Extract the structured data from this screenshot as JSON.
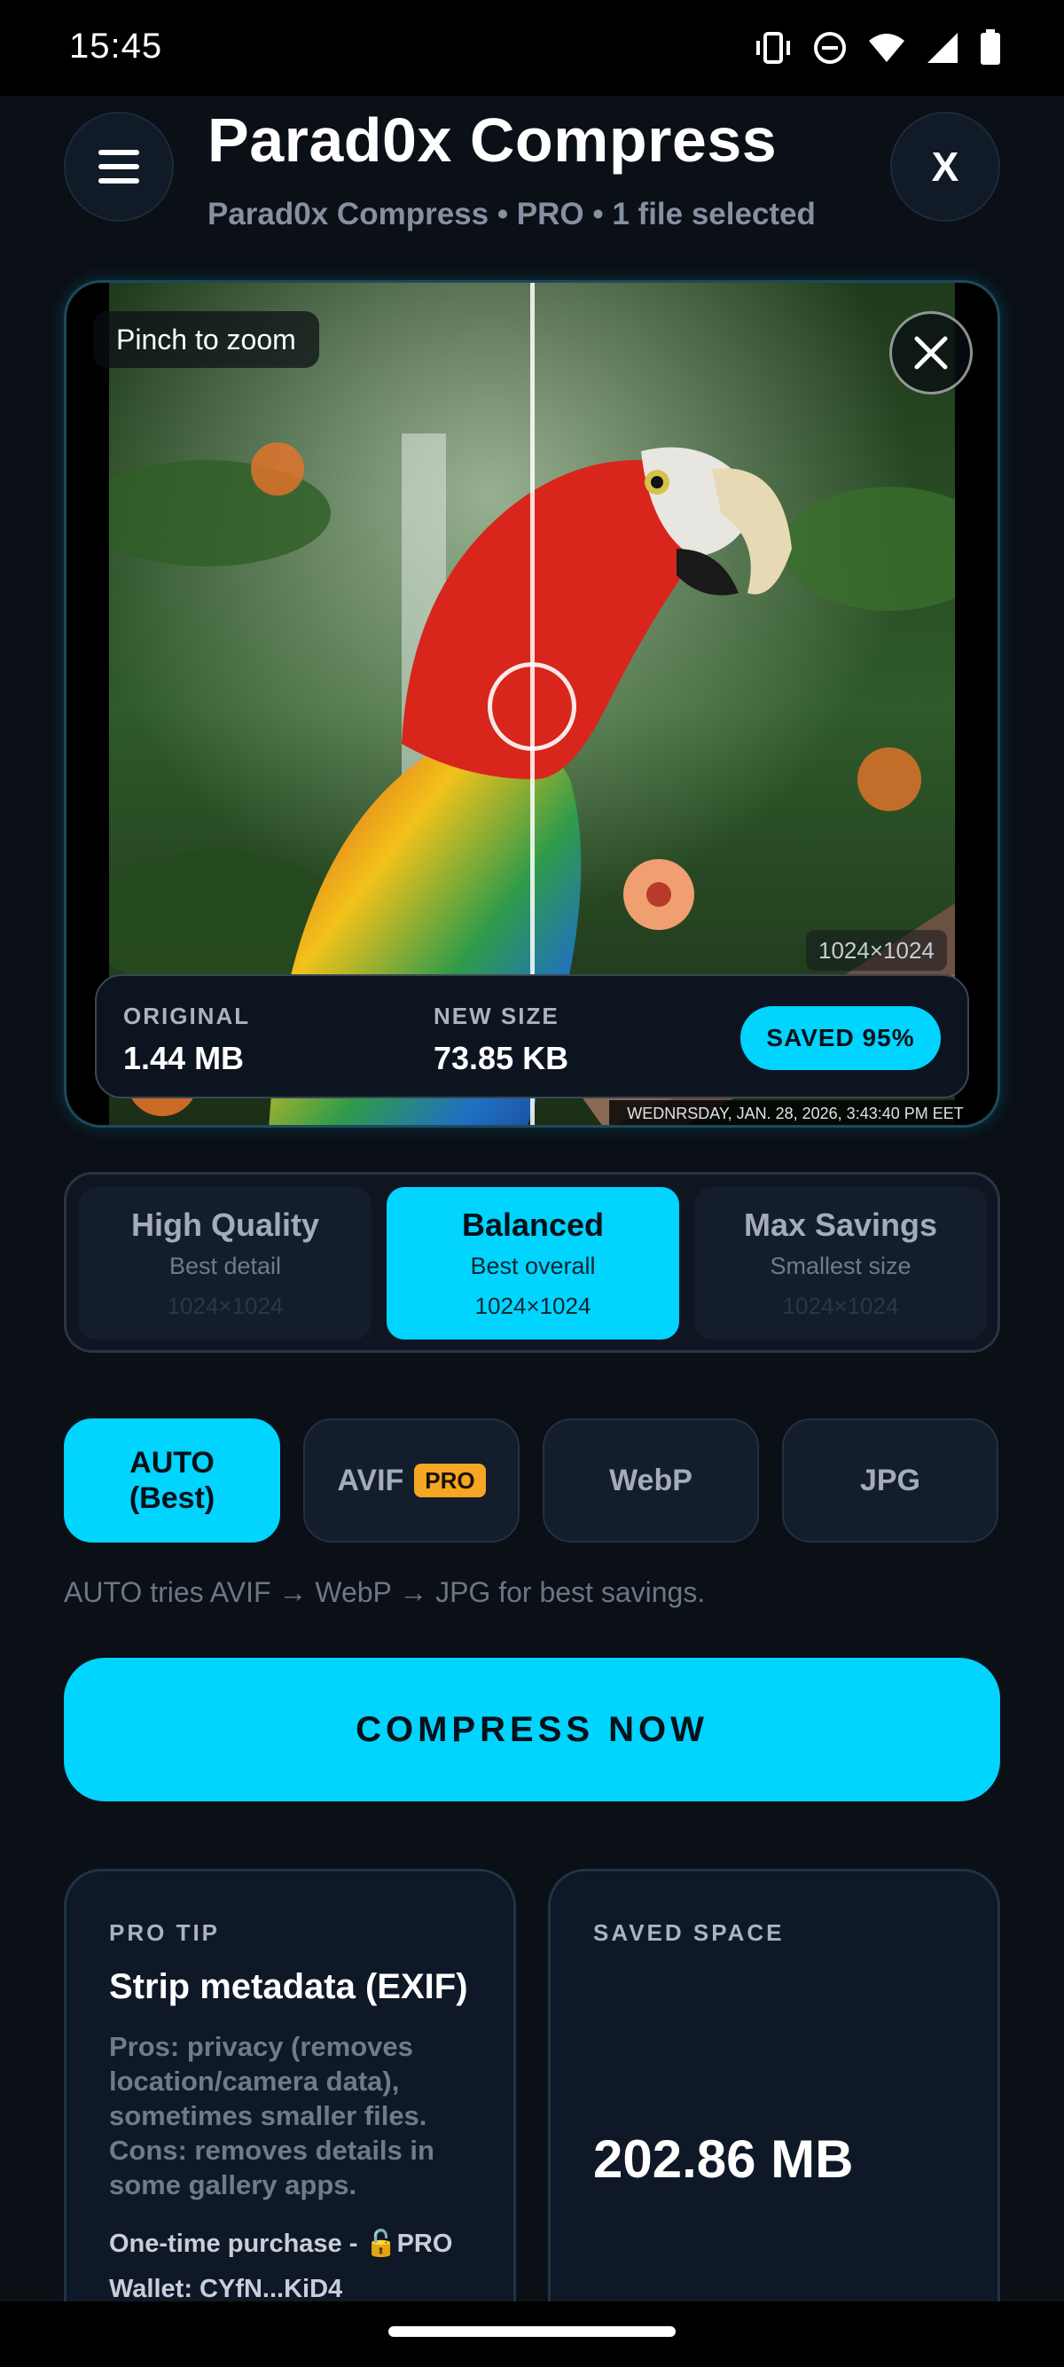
{
  "status_bar": {
    "time": "15:45",
    "icons": [
      "vibrate-icon",
      "do-not-disturb-icon",
      "wifi-icon",
      "cellular-signal-icon",
      "battery-icon"
    ]
  },
  "header": {
    "menu_icon": "hamburger-menu-icon",
    "title": "Parad0x Compress",
    "subtitle": "Parad0x Compress • PRO • 1 file selected",
    "close_label": "X"
  },
  "preview": {
    "zoom_hint": "Pinch to zoom",
    "close_icon": "close-icon",
    "resolution": "1024×1024",
    "timestamp": "WEDNRSDAY, JAN. 28, 2026, 3:43:40 PM EET",
    "original_label": "ORIGINAL",
    "original_size": "1.44 MB",
    "new_label": "NEW SIZE",
    "new_size": "73.85 KB",
    "saved_badge": "SAVED 95%",
    "compare_position": 0.5
  },
  "quality_options": [
    {
      "title": "High Quality",
      "subtitle": "Best detail",
      "resolution": "1024×1024",
      "active": false
    },
    {
      "title": "Balanced",
      "subtitle": "Best overall",
      "resolution": "1024×1024",
      "active": true
    },
    {
      "title": "Max Savings",
      "subtitle": "Smallest size",
      "resolution": "1024×1024",
      "active": false
    }
  ],
  "formats": {
    "auto_line1": "AUTO",
    "auto_line2": "(Best)",
    "avif": "AVIF",
    "avif_badge": "PRO",
    "webp": "WebP",
    "jpg": "JPG",
    "selected": "AUTO",
    "hint": "AUTO tries AVIF → WebP → JPG for best savings."
  },
  "compress_button": "COMPRESS NOW",
  "pro_tip": {
    "label": "PRO TIP",
    "title": "Strip metadata (EXIF)",
    "body": "Pros: privacy (removes location/camera data), sometimes smaller files. Cons: removes details in some gallery apps.",
    "purchase": "One-time purchase - 🔓PRO",
    "wallet": "Wallet: CYfN...KiD4"
  },
  "saved_space": {
    "label": "SAVED SPACE",
    "value": "202.86 MB"
  },
  "colors": {
    "accent": "#00d4ff",
    "background": "#0b0f16",
    "card": "#0f1826",
    "pro_badge": "#f5a623"
  }
}
